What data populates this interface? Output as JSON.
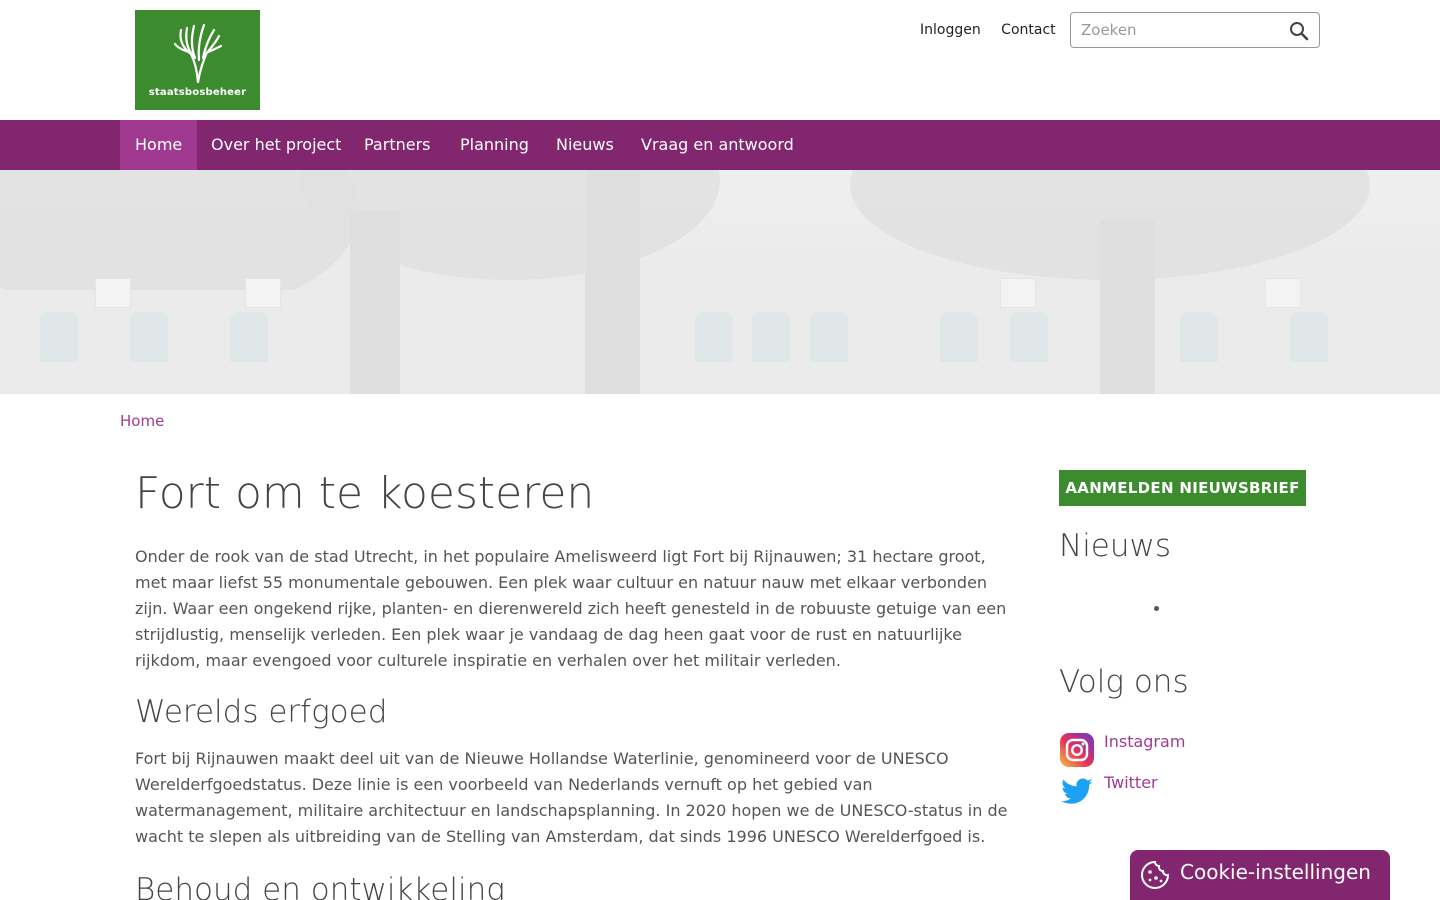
{
  "header": {
    "logo_text": "staatsbosbeheer",
    "links": [
      "Inloggen",
      "Contact"
    ],
    "search_placeholder": "Zoeken"
  },
  "nav": {
    "items": [
      "Home",
      "Over het project",
      "Partners",
      "Planning",
      "Nieuws",
      "Vraag en antwoord"
    ],
    "active": "Home"
  },
  "breadcrumb": "Home",
  "main": {
    "title": "Fort om te koesteren",
    "intro": "Onder de rook van de stad Utrecht, in het populaire Amelisweerd ligt  Fort bij Rijnauwen; 31 hectare groot, met maar liefst 55 monumentale gebouwen. Een plek waar cultuur en natuur nauw met elkaar verbonden zijn. Waar een ongekend rijke, planten- en dierenwereld zich heeft genesteld in de robuuste getuige van een strijdlustig, menselijk verleden. Een plek waar je vandaag de dag heen gaat voor de rust en natuurlijke rijkdom, maar evengoed voor culturele inspiratie en verhalen over het militair verleden.",
    "heading2": "Werelds erfgoed",
    "paragraph2": "Fort bij Rijnauwen maakt deel uit van de Nieuwe Hollandse Waterlinie, genomineerd voor de UNESCO Werelderfgoedstatus. Deze linie is een voorbeeld van Nederlands vernuft op het gebied van watermanagement, militaire architectuur en landschapsplanning. In 2020 hopen we de UNESCO-status in de wacht te slepen als uitbreiding van de Stelling van Amsterdam, dat sinds 1996 UNESCO Werelderfgoed is.",
    "heading3": "Behoud en ontwikkeling"
  },
  "sidebar": {
    "newsletter_button": "AANMELDEN NIEUWSBRIEF",
    "news_heading": "Nieuws",
    "follow_heading": "Volg ons",
    "social": [
      {
        "label": "Instagram",
        "icon": "instagram-icon"
      },
      {
        "label": "Twitter",
        "icon": "twitter-icon"
      }
    ]
  },
  "cookie": {
    "label": "Cookie-instellingen",
    "icon": "cookie-icon"
  },
  "colors": {
    "brand_purple": "#82266f",
    "active_purple": "#a03a91",
    "brand_green": "#3d8b2f",
    "twitter_blue": "#1da1f2"
  }
}
